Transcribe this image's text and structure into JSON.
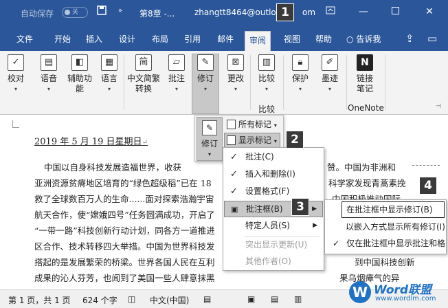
{
  "titlebar": {
    "autosave_label": "自动保存",
    "autosave_state": "关",
    "doc_title": "第8章 -...",
    "account": "zhangtt8464@outlo",
    "account_tail": "om"
  },
  "tabs": [
    "文件",
    "开始",
    "插入",
    "设计",
    "布局",
    "引用",
    "邮件",
    "审阅",
    "视图",
    "帮助"
  ],
  "active_tab": "审阅",
  "tell_me": "告诉我",
  "ribbon": {
    "buttons": [
      {
        "line1": "校对",
        "icon": "spelling-icon"
      },
      {
        "line1": "语音",
        "icon": "read-aloud-icon"
      },
      {
        "line1": "辅助功",
        "line2": "能",
        "icon": "accessibility-icon"
      },
      {
        "line1": "语言",
        "icon": "language-icon"
      },
      {
        "line1": "中文简繁",
        "line2": "转换",
        "icon": "chinese-conversion-icon",
        "glyph": "简"
      },
      {
        "line1": "批注",
        "icon": "comment-icon"
      },
      {
        "line1": "修订",
        "icon": "track-changes-icon"
      },
      {
        "line1": "更改",
        "icon": "changes-icon"
      },
      {
        "line1": "比较",
        "icon": "compare-icon"
      },
      {
        "line1": "保护",
        "icon": "protect-icon"
      },
      {
        "line1": "墨迹",
        "icon": "ink-icon"
      },
      {
        "line1": "链接",
        "line2": "笔记",
        "icon": "onenote-icon"
      }
    ],
    "group_compare": "比较",
    "group_onenote": "OneNote",
    "onenote_glyph": "N"
  },
  "document": {
    "date": "2019 年 5 月 19 日星期日",
    "lines": [
      "中国以自身科技发展造福世界，收获",
      "亚洲资源贫瘠地区培育的“绿色超级稻”已在 18",
      "救了全球数百万人的生命......面对探索浩瀚宇宙",
      "航天合作，使“嫦娥四号”任务圆满成功，开启了",
      "“一带一路”科技创新行动计划，同各方一道推进",
      "区合作、技术转移四大举措。中国为世界科技发",
      "搭起的是发展繁荣的桥梁。世界各国人民在互利",
      "成果的沁人芬芳，也闻到了美国一些人肆意抹黑"
    ],
    "right_fragments": [
      "赞。中国为非洲和",
      "科学家发现青蒿素挽",
      "中国积极推动国际",
      "到中国科技创新",
      "果乌烟瘴气的异"
    ]
  },
  "revise_panel": {
    "revise_label": "修订",
    "all_markup": "所有标记",
    "show_markup": "显示标记"
  },
  "menu": {
    "items": [
      {
        "label": "批注(C)",
        "checked": true,
        "disabled": false
      },
      {
        "label": "插入和删除(I)",
        "checked": true,
        "disabled": false
      },
      {
        "label": "设置格式(F)",
        "checked": true,
        "disabled": false
      },
      {
        "label": "批注框(B)",
        "checked": false,
        "disabled": false,
        "submenu": true,
        "highlight": true
      },
      {
        "label": "特定人员(S)",
        "checked": false,
        "disabled": false,
        "submenu": true
      },
      {
        "label": "突出显示更新(U)",
        "checked": false,
        "disabled": true
      },
      {
        "label": "其他作者(O)",
        "checked": false,
        "disabled": true
      }
    ]
  },
  "submenu": {
    "items": [
      {
        "label": "在批注框中显示修订(B)",
        "checked": false,
        "boxed": true
      },
      {
        "label": "以嵌入方式显示所有修订(I)",
        "checked": false
      },
      {
        "label": "仅在批注框中显示批注和格",
        "checked": true
      }
    ]
  },
  "badges": [
    "1",
    "2",
    "3",
    "4"
  ],
  "statusbar": {
    "page": "第 1 页，共 1 页",
    "words": "624 个字",
    "language": "中文(中国)"
  },
  "watermark": {
    "brand": "Word联盟",
    "site": "www.wordlm.com"
  }
}
